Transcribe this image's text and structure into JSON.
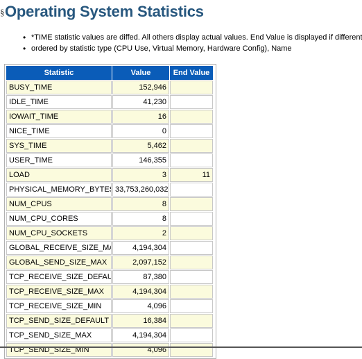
{
  "page": {
    "title": "Operating System Statistics",
    "anchor_glyph": "§"
  },
  "notes": [
    "*TIME statistic values are diffed. All others display actual values. End Value is displayed if different",
    "ordered by statistic type (CPU Use, Virtual Memory, Hardware Config), Name"
  ],
  "table": {
    "columns": [
      "Statistic",
      "Value",
      "End Value"
    ],
    "rows": [
      {
        "statistic": "BUSY_TIME",
        "value": "152,946",
        "end_value": ""
      },
      {
        "statistic": "IDLE_TIME",
        "value": "41,230",
        "end_value": ""
      },
      {
        "statistic": "IOWAIT_TIME",
        "value": "16",
        "end_value": ""
      },
      {
        "statistic": "NICE_TIME",
        "value": "0",
        "end_value": ""
      },
      {
        "statistic": "SYS_TIME",
        "value": "5,462",
        "end_value": ""
      },
      {
        "statistic": "USER_TIME",
        "value": "146,355",
        "end_value": ""
      },
      {
        "statistic": "LOAD",
        "value": "3",
        "end_value": "11"
      },
      {
        "statistic": "PHYSICAL_MEMORY_BYTES",
        "value": "33,753,260,032",
        "end_value": ""
      },
      {
        "statistic": "NUM_CPUS",
        "value": "8",
        "end_value": ""
      },
      {
        "statistic": "NUM_CPU_CORES",
        "value": "8",
        "end_value": ""
      },
      {
        "statistic": "NUM_CPU_SOCKETS",
        "value": "2",
        "end_value": ""
      },
      {
        "statistic": "GLOBAL_RECEIVE_SIZE_MAX",
        "value": "4,194,304",
        "end_value": ""
      },
      {
        "statistic": "GLOBAL_SEND_SIZE_MAX",
        "value": "2,097,152",
        "end_value": ""
      },
      {
        "statistic": "TCP_RECEIVE_SIZE_DEFAULT",
        "value": "87,380",
        "end_value": ""
      },
      {
        "statistic": "TCP_RECEIVE_SIZE_MAX",
        "value": "4,194,304",
        "end_value": ""
      },
      {
        "statistic": "TCP_RECEIVE_SIZE_MIN",
        "value": "4,096",
        "end_value": ""
      },
      {
        "statistic": "TCP_SEND_SIZE_DEFAULT",
        "value": "16,384",
        "end_value": ""
      },
      {
        "statistic": "TCP_SEND_SIZE_MAX",
        "value": "4,194,304",
        "end_value": ""
      },
      {
        "statistic": "TCP_SEND_SIZE_MIN",
        "value": "4,096",
        "end_value": ""
      }
    ]
  },
  "colors": {
    "title": "#27577e",
    "header_blue": "#0a5cb8",
    "band_highlight": "#fbfbdd",
    "band_plain": "#ffffff"
  }
}
